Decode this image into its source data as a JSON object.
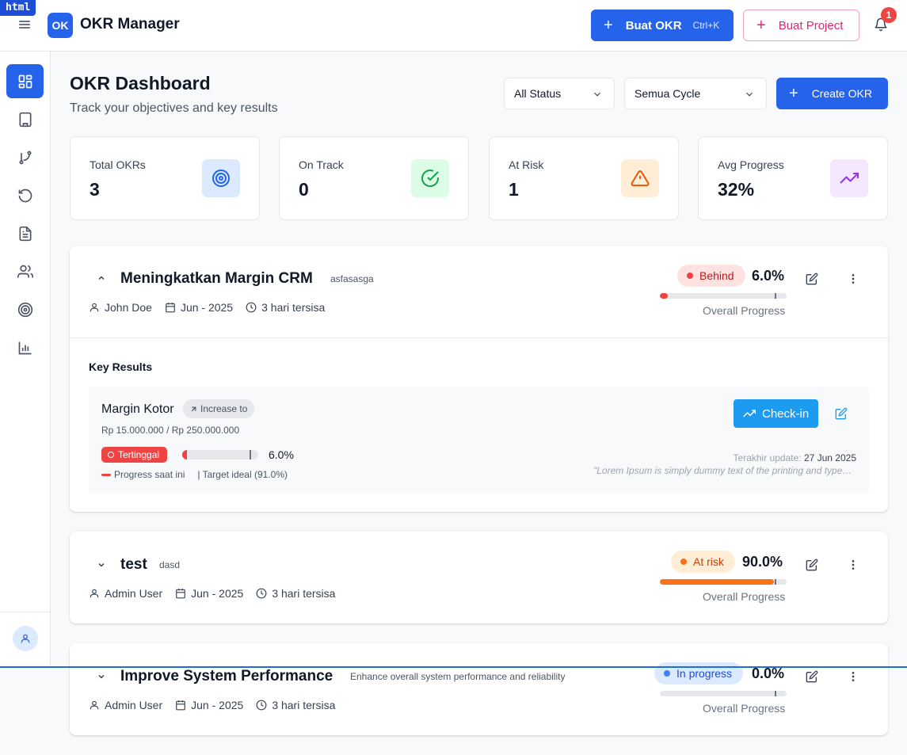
{
  "dev_badge": "html",
  "app": {
    "logo": "OK",
    "title": "OKR Manager"
  },
  "topbar": {
    "buat_okr_label": "Buat OKR",
    "buat_okr_shortcut": "Ctrl+K",
    "buat_project_label": "Buat Project",
    "notification_count": "1"
  },
  "sidebar": {
    "items": [
      {
        "icon": "dashboard-icon",
        "active": true
      },
      {
        "icon": "building-icon",
        "active": false
      },
      {
        "icon": "branch-icon",
        "active": false
      },
      {
        "icon": "history-icon",
        "active": false
      },
      {
        "icon": "document-icon",
        "active": false
      },
      {
        "icon": "users-icon",
        "active": false
      },
      {
        "icon": "target-icon",
        "active": false
      },
      {
        "icon": "bar-chart-icon",
        "active": false
      }
    ]
  },
  "header": {
    "title": "OKR Dashboard",
    "subtitle": "Track your objectives and key results",
    "status_filter": "All Status",
    "cycle_filter": "Semua Cycle",
    "create_label": "Create OKR"
  },
  "stats": [
    {
      "label": "Total OKRs",
      "value": "3",
      "icon": "target-icon",
      "bg": "#dbeafe",
      "color": "#2563eb"
    },
    {
      "label": "On Track",
      "value": "0",
      "icon": "check-circle-icon",
      "bg": "#dcfce7",
      "color": "#16a34a"
    },
    {
      "label": "At Risk",
      "value": "1",
      "icon": "warning-icon",
      "bg": "#ffedd5",
      "color": "#ea580c"
    },
    {
      "label": "Avg Progress",
      "value": "32%",
      "icon": "trending-up-icon",
      "bg": "#f3e8ff",
      "color": "#9333ea"
    }
  ],
  "okrs": [
    {
      "title": "Meningkatkan Margin CRM",
      "description": "asfasasga",
      "owner": "John Doe",
      "period": "Jun - 2025",
      "remaining": "3 hari tersisa",
      "status": "Behind",
      "status_bg": "#fee2e2",
      "status_color": "#b91c1c",
      "status_dot": "#ef4444",
      "progress_label": "6.0%",
      "progress": 6.0,
      "bar_color": "#ef4444",
      "overall_label": "Overall Progress",
      "expanded": true
    },
    {
      "title": "test",
      "description": "dasd",
      "owner": "Admin User",
      "period": "Jun - 2025",
      "remaining": "3 hari tersisa",
      "status": "At risk",
      "status_bg": "#ffedd5",
      "status_color": "#c2410c",
      "status_dot": "#f97316",
      "progress_label": "90.0%",
      "progress": 90.0,
      "bar_color": "#f97316",
      "overall_label": "Overall Progress",
      "expanded": false
    },
    {
      "title": "Improve System Performance",
      "description": "Enhance overall system performance and reliability",
      "owner": "Admin User",
      "period": "Jun - 2025",
      "remaining": "3 hari tersisa",
      "status": "In progress",
      "status_bg": "#dbeafe",
      "status_color": "#1d4ed8",
      "status_dot": "#3b82f6",
      "progress_label": "0.0%",
      "progress": 0.0,
      "bar_color": "#3b82f6",
      "overall_label": "Overall Progress",
      "expanded": false
    }
  ],
  "key_results": {
    "heading": "Key Results",
    "items": [
      {
        "title": "Margin Kotor",
        "type": "Increase to",
        "values": "Rp 15.000.000 / Rp 250.000.000",
        "status": "Tertinggal",
        "progress_label": "6.0%",
        "progress": 6.0,
        "target_ideal": 91.0,
        "legend_current": "Progress saat ini",
        "legend_target": "| Target ideal (91.0%)",
        "checkin_label": "Check-in",
        "update_label": "Terakhir update:",
        "update_date": "27 Jun 2025",
        "note": "\"Lorem Ipsum is simply dummy text of the printing and typesetting industry\""
      }
    ]
  }
}
